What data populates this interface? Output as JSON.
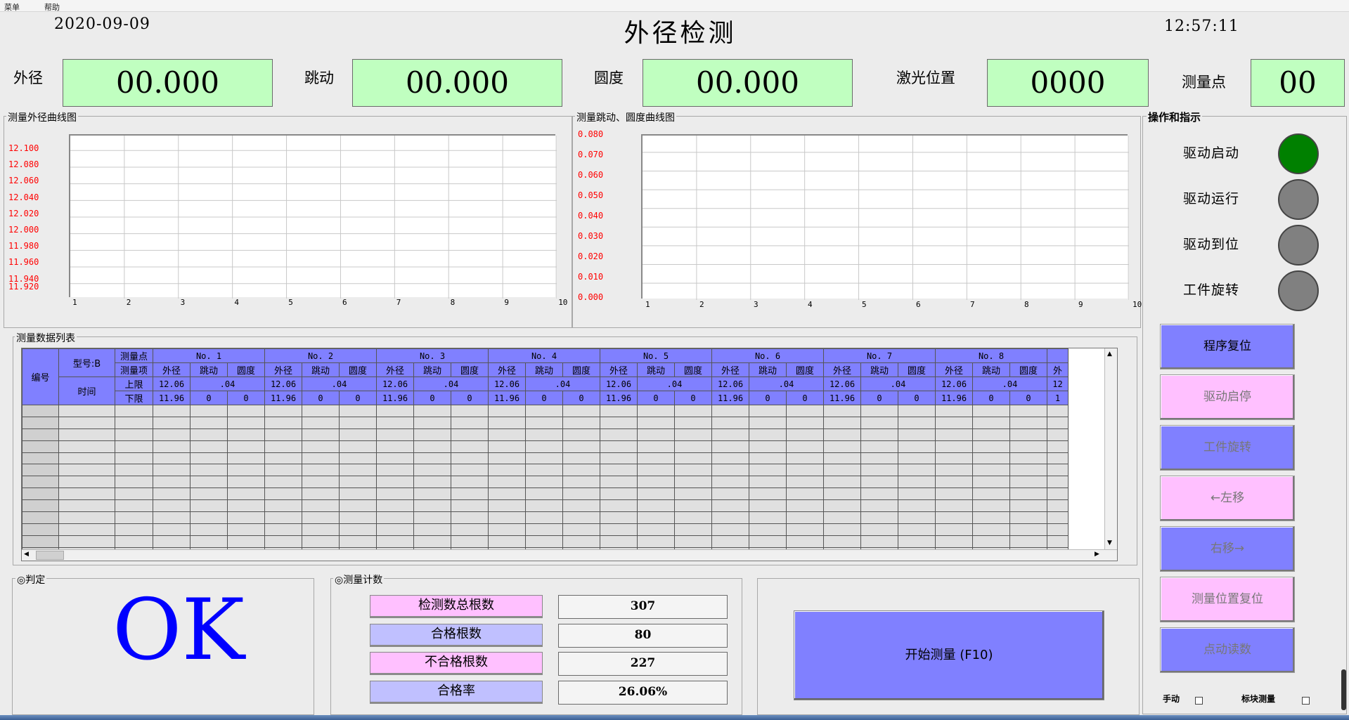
{
  "menu": [
    "菜单",
    "帮助"
  ],
  "header": {
    "date": "2020-09-09",
    "title": "外径检测",
    "time": "12:57:11"
  },
  "readouts": [
    {
      "label": "外径",
      "value": "00.000"
    },
    {
      "label": "跳动",
      "value": "00.000"
    },
    {
      "label": "圆度",
      "value": "00.000"
    },
    {
      "label": "激光位置",
      "value": "0000"
    },
    {
      "label": "测量点",
      "value": "00"
    }
  ],
  "chart_data": [
    {
      "type": "line",
      "title": "测量外径曲线图",
      "x_ticks": [
        "1",
        "2",
        "3",
        "4",
        "5",
        "6",
        "7",
        "8",
        "9",
        "10"
      ],
      "y_ticks": [
        "12.100",
        "12.080",
        "12.060",
        "12.040",
        "12.020",
        "12.000",
        "11.980",
        "11.960",
        "11.940",
        "11.920"
      ],
      "ylim": [
        11.92,
        12.1
      ],
      "series": [],
      "grid": true
    },
    {
      "type": "line",
      "title": "测量跳动、圆度曲线图",
      "x_ticks": [
        "1",
        "2",
        "3",
        "4",
        "5",
        "6",
        "7",
        "8",
        "9",
        "10"
      ],
      "y_ticks": [
        "0.080",
        "0.070",
        "0.060",
        "0.050",
        "0.040",
        "0.030",
        "0.020",
        "0.010",
        "0.000"
      ],
      "ylim": [
        0.0,
        0.08
      ],
      "series": [],
      "grid": true
    }
  ],
  "panel_ops": {
    "title": "操作和指示",
    "indicators": [
      {
        "label": "驱动启动",
        "color": "#008000"
      },
      {
        "label": "驱动运行",
        "color": "#808080"
      },
      {
        "label": "驱动到位",
        "color": "#808080"
      },
      {
        "label": "工件旋转",
        "color": "#808080"
      }
    ],
    "buttons": [
      {
        "label": "程序复位",
        "style": "blue",
        "enabled": true
      },
      {
        "label": "驱动启停",
        "style": "pink",
        "enabled": false
      },
      {
        "label": "工件旋转",
        "style": "blue",
        "enabled": false
      },
      {
        "label": "←左移",
        "style": "pink",
        "enabled": false
      },
      {
        "label": "右移→",
        "style": "blue",
        "enabled": false
      },
      {
        "label": "测量位置复位",
        "style": "pink",
        "enabled": false
      },
      {
        "label": "点动读数",
        "style": "blue",
        "enabled": false
      }
    ],
    "checks": [
      {
        "label": "手动"
      },
      {
        "label": "标块测量"
      }
    ]
  },
  "table": {
    "title": "测量数据列表",
    "col_id": "编号",
    "model": "型号:B",
    "time": "时间",
    "row_labels": [
      "测量点",
      "测量项",
      "上限",
      "下限"
    ],
    "groups": [
      "No. 1",
      "No. 2",
      "No. 3",
      "No. 4",
      "No. 5",
      "No. 6",
      "No. 7",
      "No. 8"
    ],
    "items": [
      "外径",
      "跳动",
      "圆度"
    ],
    "upper": [
      "12.06",
      ".04"
    ],
    "lower": [
      "11.96",
      "0",
      "0"
    ],
    "partial_col": {
      "item": "外",
      "upper": "12",
      "lower": "1"
    },
    "empty_rows": 13
  },
  "judge": {
    "title": "◎判定",
    "result": "OK"
  },
  "counts": {
    "title": "◎测量计数",
    "rows": [
      {
        "label": "检测数总根数",
        "value": "307",
        "color": "#ffc0ff"
      },
      {
        "label": "合格根数",
        "value": "80",
        "color": "#c0c0ff"
      },
      {
        "label": "不合格根数",
        "value": "227",
        "color": "#ffc0ff"
      },
      {
        "label": "合格率",
        "value": "26.06%",
        "color": "#c0c0ff"
      }
    ]
  },
  "start": {
    "label": "开始测量  (F10)"
  }
}
